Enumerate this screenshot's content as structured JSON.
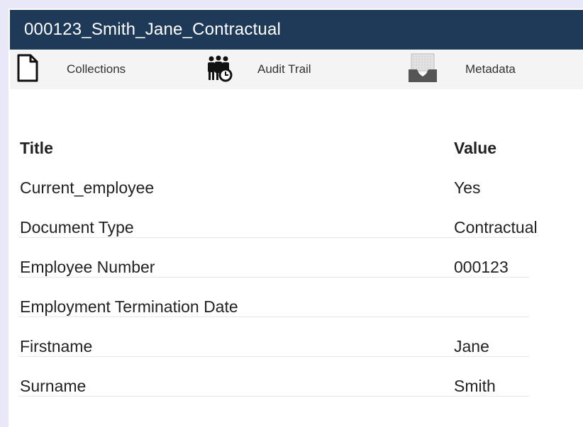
{
  "window": {
    "title": "000123_Smith_Jane_Contractual"
  },
  "toolbar": {
    "collections_label": "Collections",
    "audit_trail_label": "Audit Trail",
    "metadata_label": "Metadata"
  },
  "metadata_table": {
    "headers": {
      "title": "Title",
      "value": "Value"
    },
    "rows": [
      {
        "title": "Current_employee",
        "value": "Yes"
      },
      {
        "title": "Document Type",
        "value": "Contractual"
      },
      {
        "title": "Employee Number",
        "value": "000123"
      },
      {
        "title": "Employment Termination Date",
        "value": ""
      },
      {
        "title": "Firstname",
        "value": "Jane"
      },
      {
        "title": "Surname",
        "value": "Smith"
      }
    ]
  },
  "colors": {
    "titlebar_bg": "#1e3a58",
    "titlebar_text": "#ffffff",
    "page_bg": "#e8e8f8"
  }
}
